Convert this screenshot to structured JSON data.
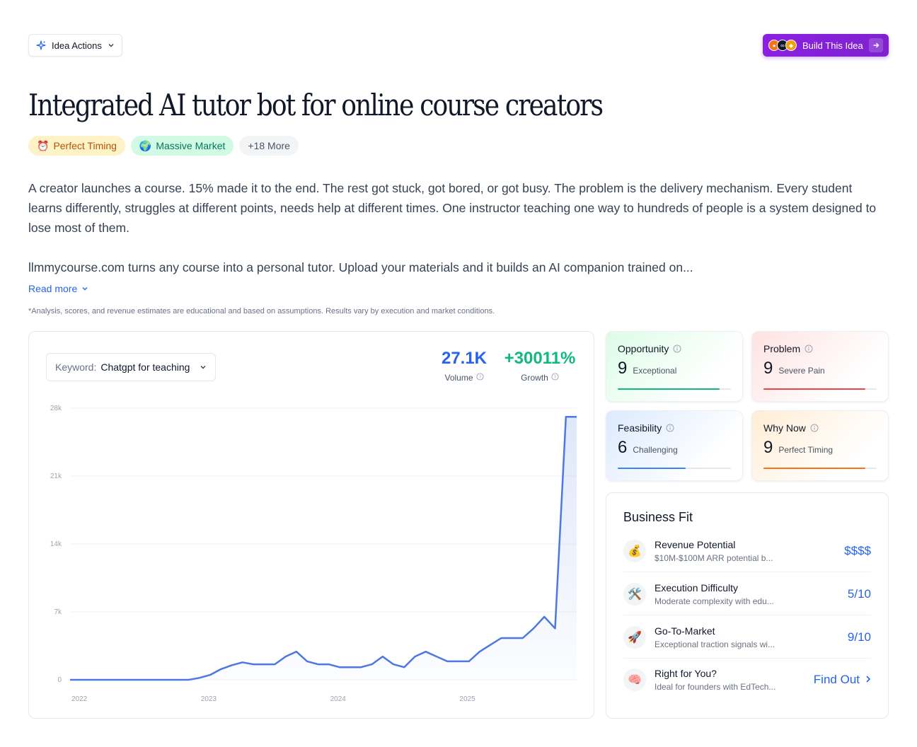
{
  "header": {
    "actions_label": "Idea Actions",
    "build_label": "Build This Idea"
  },
  "title": "Integrated AI tutor bot for online course creators",
  "tags": [
    {
      "emoji": "⏰",
      "label": "Perfect Timing"
    },
    {
      "emoji": "🌍",
      "label": "Massive Market"
    },
    {
      "emoji": "",
      "label": "+18 More"
    }
  ],
  "description": {
    "paragraph1": "A creator launches a course. 15% made it to the end. The rest got stuck, got bored, or got busy. The problem is the delivery mechanism. Every student learns differently, struggles at different points, needs help at different times. One instructor teaching one way to hundreds of people is a system designed to lose most of them.",
    "paragraph2": "llmmycourse.com turns any course into a personal tutor. Upload your materials and it builds an AI companion trained on...",
    "read_more": "Read more"
  },
  "disclaimer": "*Analysis, scores, and revenue estimates are educational and based on assumptions. Results vary by execution and market conditions.",
  "trend": {
    "keyword_label": "Keyword:",
    "keyword_value": "Chatgpt for teaching",
    "volume": "27.1K",
    "volume_label": "Volume",
    "growth": "+30011%",
    "growth_label": "Growth"
  },
  "chart_data": {
    "type": "area",
    "title": "",
    "xlabel": "",
    "ylabel": "",
    "ylim": [
      0,
      28000
    ],
    "y_ticks": [
      "0",
      "7k",
      "14k",
      "21k",
      "28k"
    ],
    "x_ticks": [
      "2022",
      "2023",
      "2024",
      "2025"
    ],
    "line_color": "#4c78e0",
    "series": [
      {
        "x": [
          "2022-01",
          "2022-02",
          "2022-03",
          "2022-04",
          "2022-05",
          "2022-06",
          "2022-07",
          "2022-08",
          "2022-09",
          "2022-10",
          "2022-11",
          "2022-12",
          "2023-01",
          "2023-02",
          "2023-03",
          "2023-04",
          "2023-05",
          "2023-06",
          "2023-07",
          "2023-08",
          "2023-09",
          "2023-10",
          "2023-11",
          "2023-12",
          "2024-01",
          "2024-02",
          "2024-03",
          "2024-04",
          "2024-05",
          "2024-06",
          "2024-07",
          "2024-08",
          "2024-09",
          "2024-10",
          "2024-11",
          "2024-12",
          "2025-01",
          "2025-02",
          "2025-03",
          "2025-04",
          "2025-05",
          "2025-06",
          "2025-07",
          "2025-08",
          "2025-09",
          "2025-10",
          "2025-11",
          "2025-12"
        ],
        "values": [
          0,
          0,
          0,
          0,
          0,
          0,
          0,
          0,
          0,
          0,
          0,
          0,
          200,
          500,
          1100,
          1500,
          1800,
          1600,
          1600,
          1600,
          2400,
          2900,
          1900,
          1600,
          1600,
          1300,
          1300,
          1300,
          1600,
          2400,
          1600,
          1300,
          2400,
          2900,
          2400,
          1900,
          1900,
          1900,
          2900,
          3600,
          4300,
          4300,
          4300,
          5300,
          6500,
          5300,
          27100,
          27100
        ]
      }
    ]
  },
  "scores": {
    "opportunity": {
      "label": "Opportunity",
      "value": "9",
      "desc": "Exceptional",
      "fraction": 0.9,
      "color": "#10b981"
    },
    "problem": {
      "label": "Problem",
      "value": "9",
      "desc": "Severe Pain",
      "fraction": 0.9,
      "color": "#ef4444"
    },
    "feasibility": {
      "label": "Feasibility",
      "value": "6",
      "desc": "Challenging",
      "fraction": 0.6,
      "color": "#3b82f6"
    },
    "why_now": {
      "label": "Why Now",
      "value": "9",
      "desc": "Perfect Timing",
      "fraction": 0.9,
      "color": "#f97316"
    }
  },
  "business_fit": {
    "title": "Business Fit",
    "rows": [
      {
        "icon": "💰",
        "name": "Revenue Potential",
        "sub": "$10M-$100M ARR potential b...",
        "value": "$$$$"
      },
      {
        "icon": "🛠️",
        "name": "Execution Difficulty",
        "sub": "Moderate complexity with edu...",
        "value": "5/10"
      },
      {
        "icon": "🚀",
        "name": "Go-To-Market",
        "sub": "Exceptional traction signals wi...",
        "value": "9/10"
      },
      {
        "icon": "🧠",
        "name": "Right for You?",
        "sub": "Ideal for founders with EdTech...",
        "value": "Find Out"
      }
    ]
  }
}
